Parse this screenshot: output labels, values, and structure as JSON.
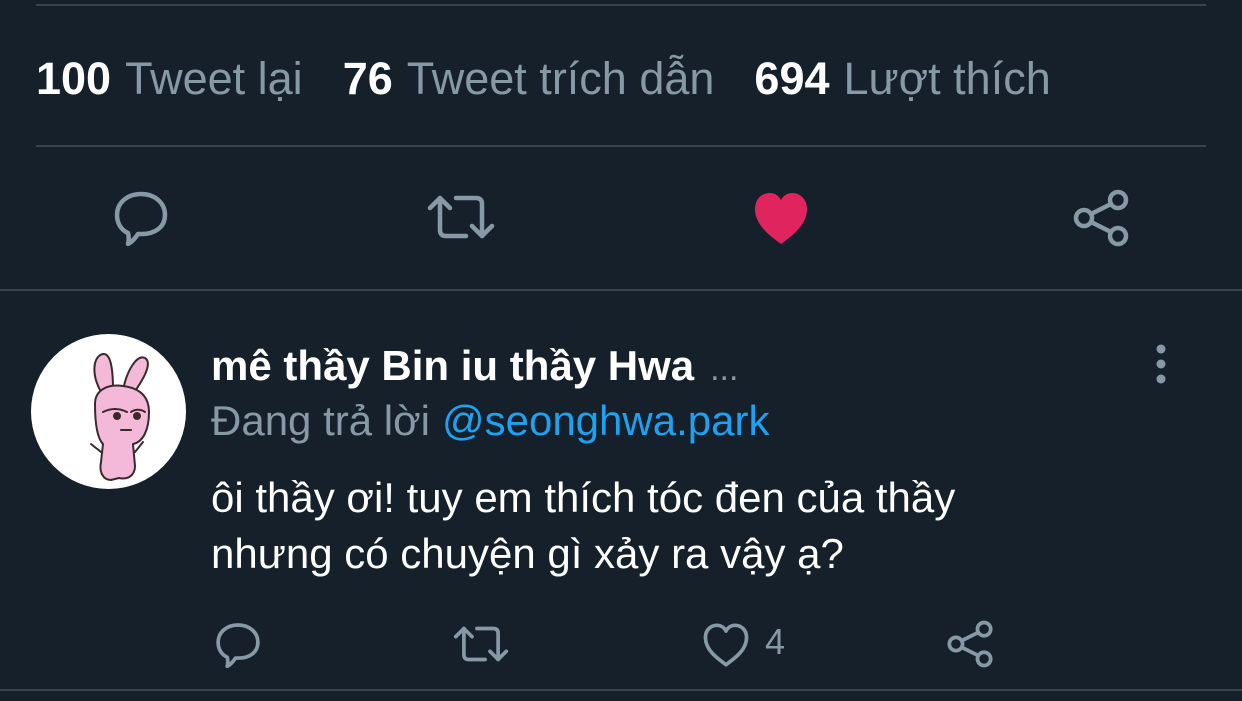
{
  "stats": {
    "retweets": {
      "count": "100",
      "label": "Tweet lại"
    },
    "quotes": {
      "count": "76",
      "label": "Tweet trích dẫn"
    },
    "likes": {
      "count": "694",
      "label": "Lượt thích"
    }
  },
  "main_actions": {
    "icons": [
      "reply-icon",
      "retweet-icon",
      "like-icon-filled",
      "share-icon"
    ],
    "liked": true,
    "like_color": "#e0245e"
  },
  "reply": {
    "display_name": "mê thầy Bin iu thầy Hwa",
    "name_overflow": "...",
    "replying_prefix": "Đang trả lời",
    "replying_handle": "@seonghwa.park",
    "text_line1": "ôi thầy ơi! tuy em thích tóc đen của thầy",
    "text_line2": "nhưng có chuyện gì xảy ra vậy ạ?",
    "like_count": "4"
  },
  "colors": {
    "background": "#15202b",
    "text_primary": "#ffffff",
    "text_secondary": "#8899a6",
    "link": "#1da1f2",
    "divider": "#38444d"
  }
}
